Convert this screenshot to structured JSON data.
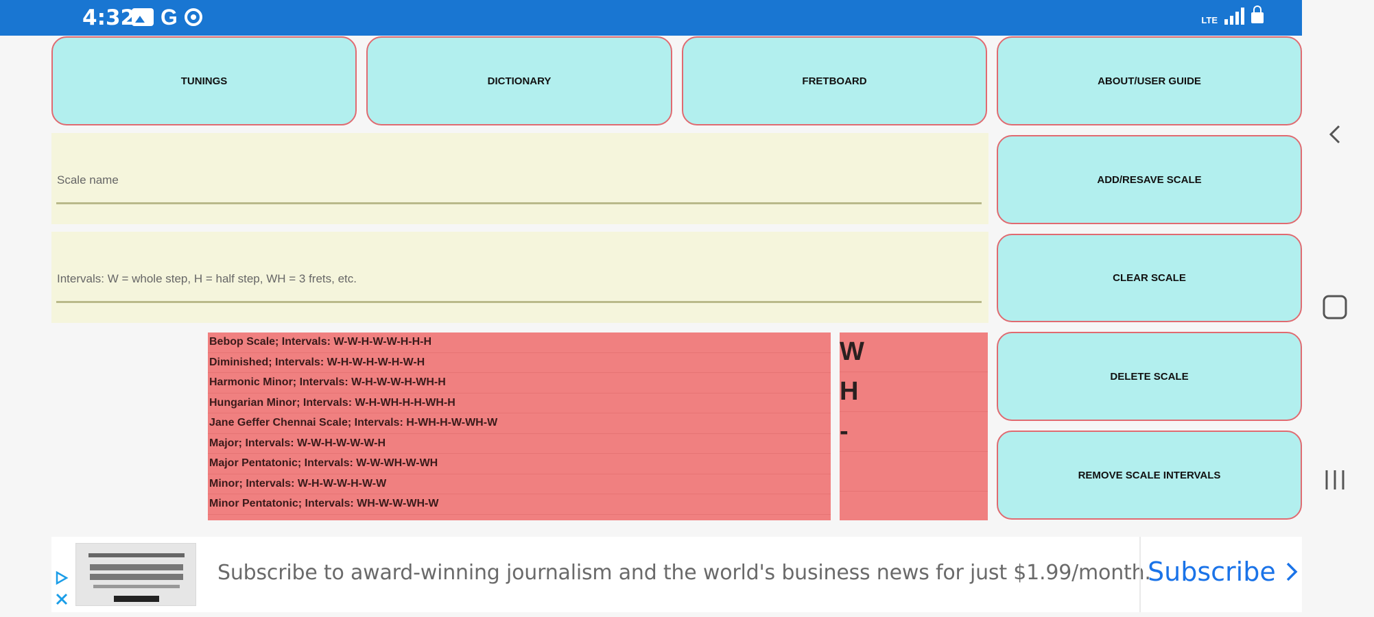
{
  "status_bar": {
    "time": "4:32",
    "network_label": "LTE",
    "left_icons": [
      "gallery-icon",
      "google-icon",
      "circle-icon"
    ],
    "right_icons": [
      "signal-icon",
      "lock-icon"
    ]
  },
  "nav_buttons": {
    "tunings": "TUNINGS",
    "dictionary": "DICTIONARY",
    "fretboard": "FRETBOARD",
    "about": "ABOUT/USER GUIDE"
  },
  "action_buttons": {
    "add_resave": "ADD/RESAVE SCALE",
    "clear": "CLEAR SCALE",
    "delete": "DELETE SCALE",
    "remove_intervals": "REMOVE SCALE INTERVALS"
  },
  "inputs": {
    "scale_name_placeholder": "Scale name",
    "intervals_placeholder": "Intervals: W = whole step, H = half step, WH = 3 frets, etc."
  },
  "scales": [
    "Bebop Scale;  Intervals: W-W-H-W-W-H-H-H",
    "Diminished;  Intervals: W-H-W-H-W-H-W-H",
    "Harmonic Minor;  Intervals: W-H-W-W-H-WH-H",
    "Hungarian Minor;  Intervals: W-H-WH-H-H-WH-H",
    "Jane Geffer Chennai Scale;  Intervals: H-WH-H-W-WH-W",
    "Major;  Intervals: W-W-H-W-W-W-H",
    "Major Pentatonic;  Intervals: W-W-WH-W-WH",
    "Minor;  Intervals: W-H-W-W-H-W-W",
    "Minor Pentatonic;  Intervals: WH-W-W-WH-W"
  ],
  "interval_options": [
    "W",
    "H",
    "-"
  ],
  "ad": {
    "text": "Subscribe to award-winning journalism and the world's business news for just $1.99/month.",
    "cta": "Subscribe"
  },
  "colors": {
    "status_bar": "#1976d2",
    "button_fill": "#b2efee",
    "button_border": "#e06a70",
    "input_fill": "#f5f5dc",
    "list_fill": "#f08080",
    "ad_link": "#1a73e8"
  }
}
